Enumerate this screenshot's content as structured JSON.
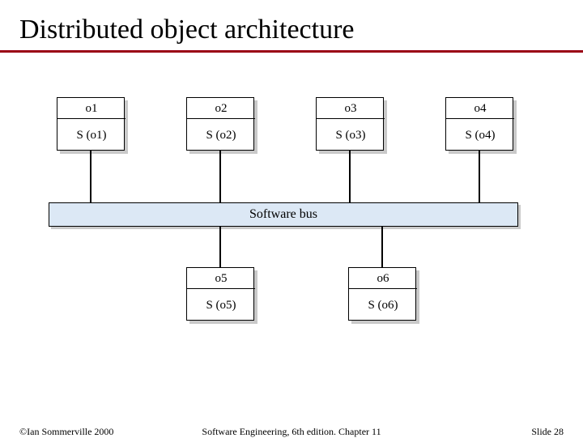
{
  "title": "Distributed object architecture",
  "objects_top": [
    {
      "name": "o1",
      "service": "S (o1)"
    },
    {
      "name": "o2",
      "service": "S (o2)"
    },
    {
      "name": "o3",
      "service": "S (o3)"
    },
    {
      "name": "o4",
      "service": "S (o4)"
    }
  ],
  "objects_bottom": [
    {
      "name": "o5",
      "service": "S (o5)"
    },
    {
      "name": "o6",
      "service": "S (o6)"
    }
  ],
  "bus_label": "Software bus",
  "footer": {
    "copyright": "©Ian Sommerville 2000",
    "center": "Software Engineering, 6th edition. Chapter 11",
    "slide": "Slide 28"
  }
}
